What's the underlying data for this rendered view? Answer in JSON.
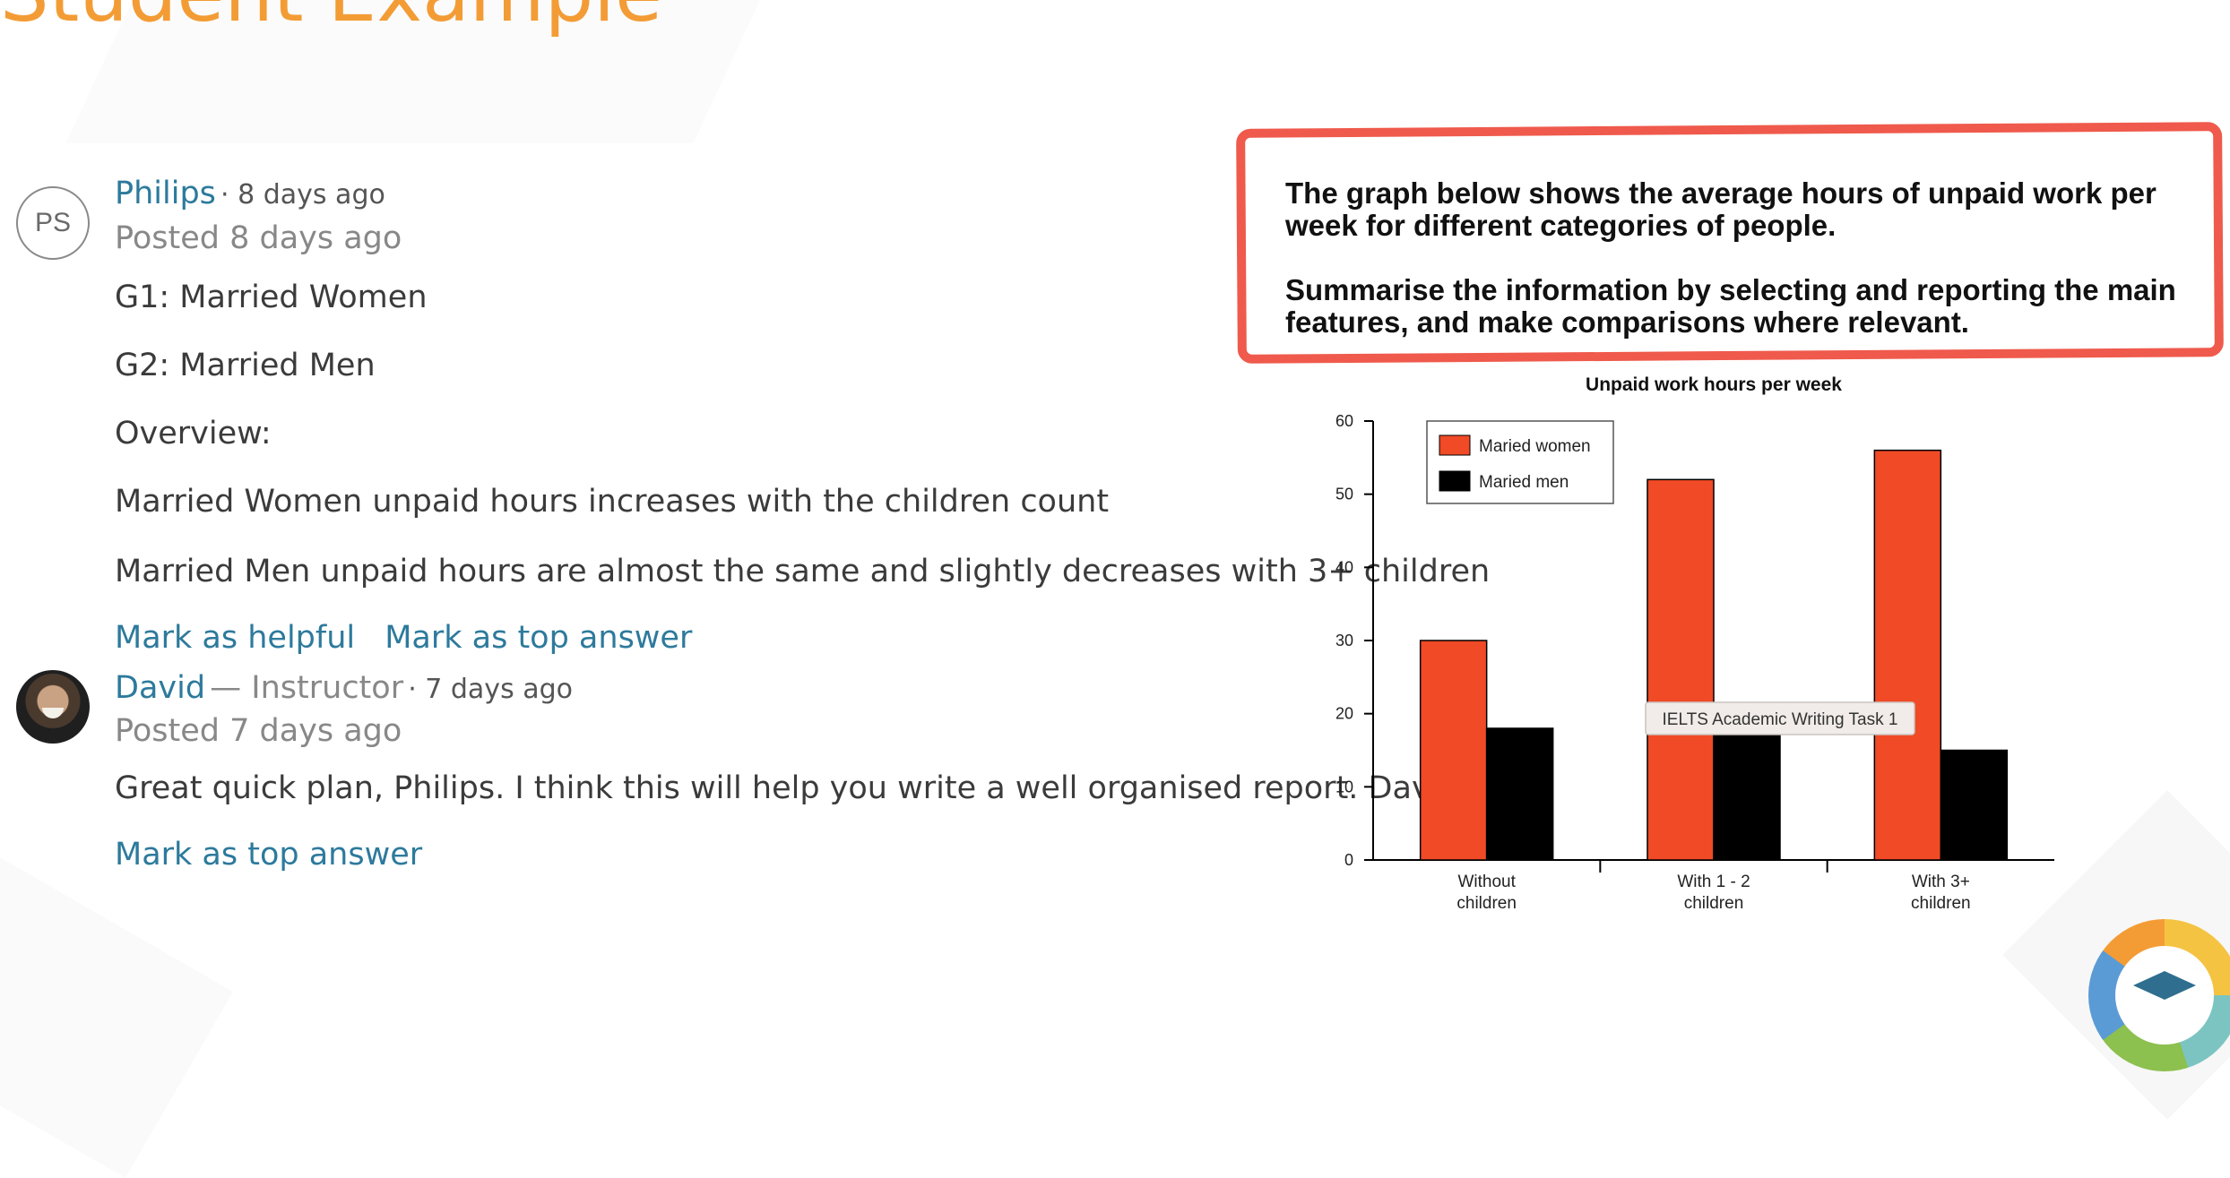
{
  "page": {
    "heading": "Student Example"
  },
  "posts": [
    {
      "avatar_initials": "PS",
      "author": "Philips",
      "meta": "· 8 days ago",
      "posted": "Posted 8 days ago",
      "lines": [
        "G1: Married Women",
        "G2: Married Men",
        "Overview:",
        "Married Women unpaid hours increases with the children count",
        "Married Men unpaid hours are almost the same and slightly decreases with 3+ children"
      ],
      "actions": [
        "Mark as helpful",
        "Mark as top answer"
      ]
    },
    {
      "author": "David",
      "role": "— Instructor",
      "meta": "· 7 days ago",
      "posted": "Posted 7 days ago",
      "lines": [
        "Great quick plan, Philips. I think this will help you write a well organised report. David"
      ],
      "actions": [
        "Mark as top answer"
      ]
    }
  ],
  "prompt": {
    "line1": "The graph below shows the average hours of unpaid work per week for different categories of people.",
    "line2": "Summarise the information by selecting and reporting the main features, and make comparisons where relevant."
  },
  "chart_data": {
    "type": "bar",
    "title": "Unpaid work hours per week",
    "categories": [
      "Without children",
      "With 1 - 2 children",
      "With 3+ children"
    ],
    "series": [
      {
        "name": "Maried women",
        "values": [
          30,
          52,
          56
        ],
        "color": "#f04a26"
      },
      {
        "name": "Maried men",
        "values": [
          18,
          17,
          15
        ],
        "color": "#000000"
      }
    ],
    "ylim": [
      0,
      60
    ],
    "yticks": [
      0,
      10,
      20,
      30,
      40,
      50,
      60
    ],
    "legend": "top-left",
    "grid": false,
    "annotation": "IELTS Academic Writing Task 1"
  },
  "colors": {
    "accent": "#f39c35",
    "link": "#2d7a9c",
    "highlight_box": "#ef5a4c"
  }
}
